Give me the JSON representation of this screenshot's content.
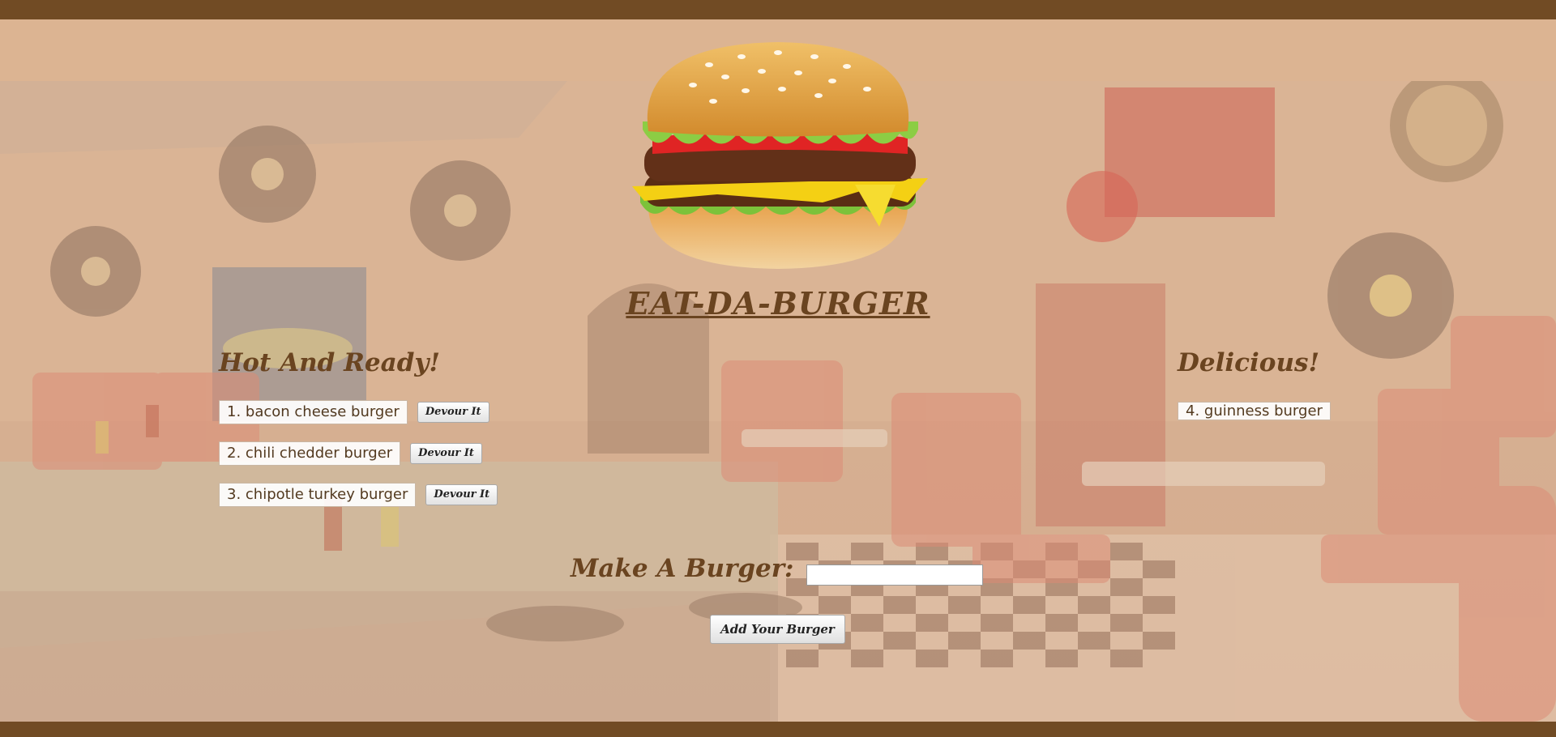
{
  "header": {
    "title": "EAT-DA-BURGER",
    "logo_icon": "hamburger-icon"
  },
  "hot": {
    "title": "Hot And Ready!",
    "items": [
      {
        "label": "1. bacon cheese burger",
        "button": "Devour It"
      },
      {
        "label": "2. chili chedder burger",
        "button": "Devour It"
      },
      {
        "label": "3. chipotle turkey burger",
        "button": "Devour It"
      }
    ]
  },
  "devoured": {
    "title": "Delicious!",
    "items": [
      {
        "label": "4. guinness burger"
      }
    ]
  },
  "form": {
    "label": "Make A Burger:",
    "input_value": "",
    "button": "Add Your Burger"
  },
  "colors": {
    "frame": "#714b24",
    "text_brown": "#6a4420",
    "band": "#dcb492"
  }
}
